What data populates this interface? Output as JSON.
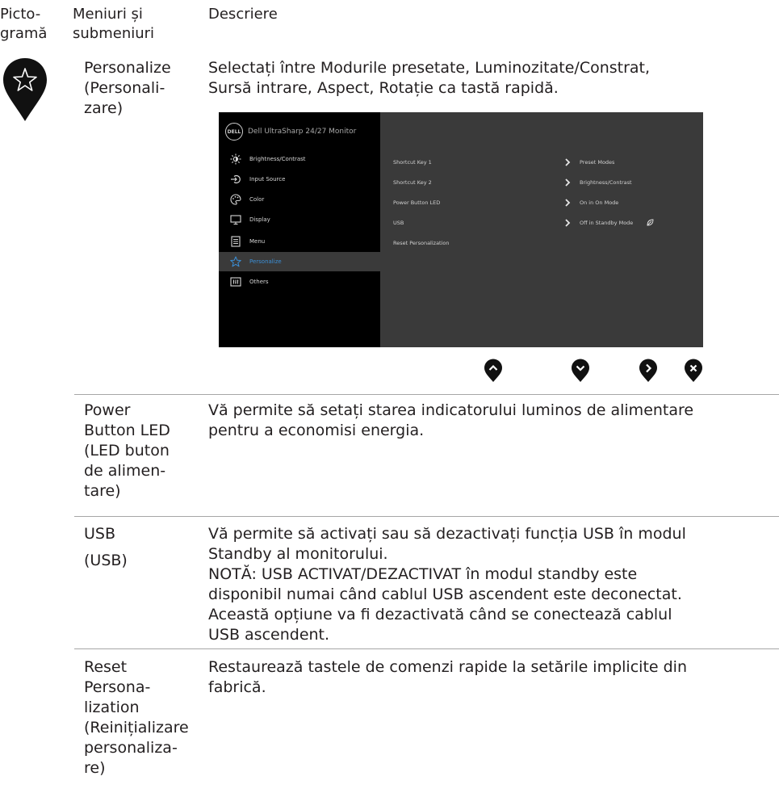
{
  "header": {
    "col1_line1": "Picto-",
    "col1_line2": "gramă",
    "col2_line1": "Meniuri și",
    "col2_line2": "submeniuri",
    "col3": "Descriere"
  },
  "personalize": {
    "name_line1": "Personalize",
    "name_line2": "(Personali-",
    "name_line3": "zare)",
    "desc_line1": "Selectați între Modurile presetate, Luminozitate/Constrat,",
    "desc_line2": "Sursă intrare, Aspect, Rotație ca tastă rapidă."
  },
  "osd": {
    "logo": "DELL",
    "title": "Dell UltraSharp 24/27 Monitor",
    "menu": [
      {
        "label": "Brightness/Contrast",
        "icon": "sun-icon"
      },
      {
        "label": "Input Source",
        "icon": "input-source-icon"
      },
      {
        "label": "Color",
        "icon": "palette-icon"
      },
      {
        "label": "Display",
        "icon": "display-icon"
      },
      {
        "label": "Menu",
        "icon": "menu-icon"
      },
      {
        "label": "Personalize",
        "icon": "star-icon",
        "active": true
      },
      {
        "label": "Others",
        "icon": "others-icon"
      }
    ],
    "options": [
      {
        "label": "Shortcut Key 1",
        "value": "Preset Modes"
      },
      {
        "label": "Shortcut Key 2",
        "value": "Brightness/Contrast"
      },
      {
        "label": "Power Button LED",
        "value": "On in On Mode"
      },
      {
        "label": "USB",
        "value": "Off in Standby Mode"
      },
      {
        "label": "Reset Personalization",
        "value": ""
      }
    ],
    "active_color": "#3b8fd6"
  },
  "nav_buttons": [
    "up-button-icon",
    "down-button-icon",
    "right-button-icon",
    "close-button-icon"
  ],
  "rows": {
    "power_led": {
      "name": [
        "Power",
        "Button LED",
        "(LED buton",
        "de alimen-",
        "tare)"
      ],
      "desc": [
        "Vă permite să setați starea indicatorului luminos de alimentare",
        "pentru a economisi energia."
      ]
    },
    "usb": {
      "name1": "USB",
      "name2": "(USB)",
      "desc": [
        "Vă permite să activați sau să dezactivați funcția USB în modul",
        "Standby al monitorului.",
        "NOTĂ: USB ACTIVAT/DEZACTIVAT în modul standby este",
        "disponibil numai când cablul USB ascendent este deconectat.",
        "Această opțiune va fi dezactivată când se conectează cablul",
        "USB ascendent."
      ]
    },
    "reset": {
      "name": [
        "Reset",
        "Persona-",
        "lization",
        "(Reinițializare",
        "personaliza-",
        "re)"
      ],
      "desc": [
        "Restaurează tastele de comenzi rapide la setările implicite din",
        "fabrică."
      ]
    }
  }
}
